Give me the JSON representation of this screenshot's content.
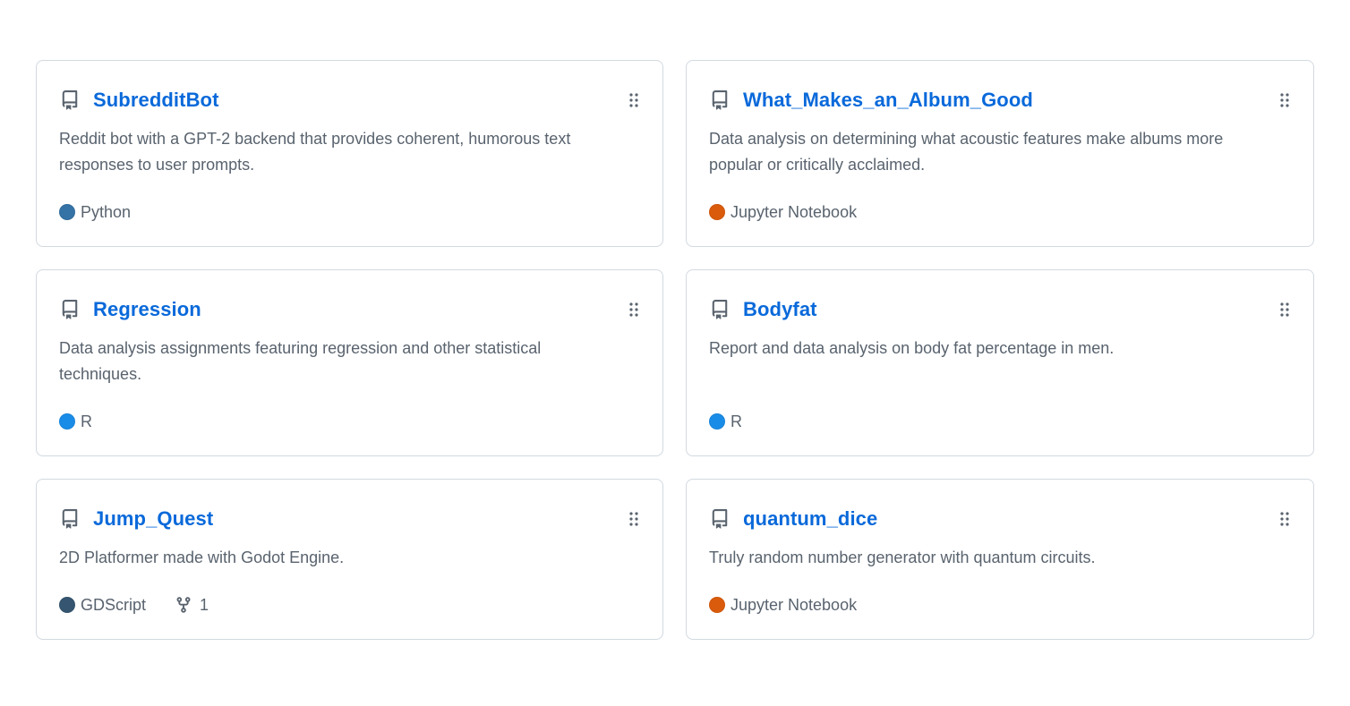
{
  "repos": [
    {
      "name": "SubredditBot",
      "description": "Reddit bot with a GPT-2 backend that provides coherent, humorous text responses to user prompts.",
      "language": "Python",
      "language_color": "#3572A5",
      "forks": null
    },
    {
      "name": "What_Makes_an_Album_Good",
      "description": "Data analysis on determining what acoustic features make albums more popular or critically acclaimed.",
      "language": "Jupyter Notebook",
      "language_color": "#DA5B0B",
      "forks": null
    },
    {
      "name": "Regression",
      "description": "Data analysis assignments featuring regression and other statistical techniques.",
      "language": "R",
      "language_color": "#198CE7",
      "forks": null
    },
    {
      "name": "Bodyfat",
      "description": "Report and data analysis on body fat percentage in men.",
      "language": "R",
      "language_color": "#198CE7",
      "forks": null
    },
    {
      "name": "Jump_Quest",
      "description": "2D Platformer made with Godot Engine.",
      "language": "GDScript",
      "language_color": "#355570",
      "forks": "1"
    },
    {
      "name": "quantum_dice",
      "description": "Truly random number generator with quantum circuits.",
      "language": "Jupyter Notebook",
      "language_color": "#DA5B0B",
      "forks": null
    }
  ],
  "icons": {
    "repo": "repo-icon",
    "drag": "grabber-icon",
    "fork": "fork-icon"
  },
  "colors": {
    "link": "#0969da",
    "muted_text": "#59636e",
    "border": "#d1d9e0"
  }
}
